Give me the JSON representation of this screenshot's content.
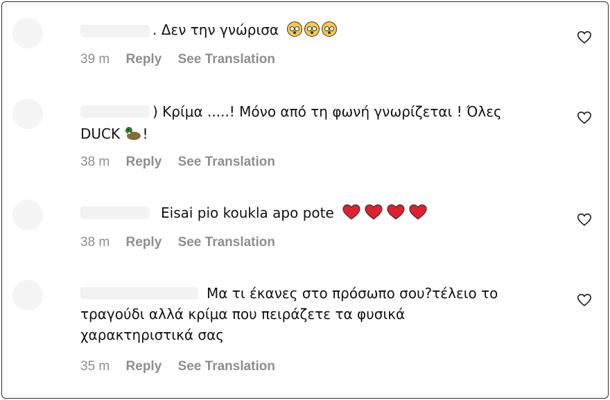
{
  "comments": [
    {
      "prefix": ".",
      "text": "Δεν την γνώρισα",
      "emoji": "flushed-face x3",
      "time": "39 m",
      "reply": "Reply",
      "translate": "See Translation"
    },
    {
      "prefix": ")",
      "text_line1": "Κρίμα .....! Μόνο από τη φωνή γνωρίζεται ! Όλες",
      "text_line2_a": "DUCK",
      "text_line2_b": "!",
      "emoji": "duck",
      "time": "38 m",
      "reply": "Reply",
      "translate": "See Translation"
    },
    {
      "text": "Eisai pio koukla apo pote",
      "emoji": "red-heart x4",
      "time": "38 m",
      "reply": "Reply",
      "translate": "See Translation"
    },
    {
      "text_line1": "Μα τι έκανες στο πρόσωπο σου?τέλειο το",
      "text_line2": "τραγούδι αλλά κρίμα που πειράζετε τα φυσικά",
      "text_line3": "χαρακτηριστικά σας",
      "time": "35 m",
      "reply": "Reply",
      "translate": "See Translation"
    }
  ],
  "colors": {
    "text": "#111111",
    "meta": "#8e8e8e",
    "heart_red": "#e0202e"
  },
  "icons": {
    "like": "heart-outline-icon"
  }
}
